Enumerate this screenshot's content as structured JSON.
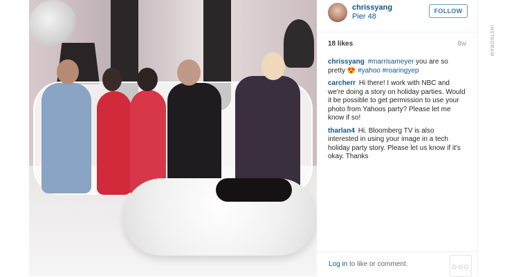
{
  "post": {
    "username": "chrissyang",
    "location": "Pier 48",
    "follow_label": "FOLLOW",
    "likes": "18 likes",
    "age": "8w"
  },
  "comments": [
    {
      "user": "chrissyang",
      "parts": [
        "#marrisameyer",
        " you are so pretty 😍 ",
        "#yahoo",
        " ",
        "#roaringyep"
      ]
    },
    {
      "user": "carcherr",
      "text": "Hi there! I work with NBC and we're doing a story on holiday parties. Would it be possible to get permission to use your photo from Yahoos party? Please let me know if so!"
    },
    {
      "user": "tharlan4",
      "text": "Hi. Bloomberg TV is also interested in using your image in a tech holiday party story. Please let us know if it's okay. Thanks"
    }
  ],
  "footer": {
    "login_link": "Log in",
    "login_suffix": " to like or comment.",
    "more_label": "○○○"
  },
  "credit": "INSTAGRAM"
}
